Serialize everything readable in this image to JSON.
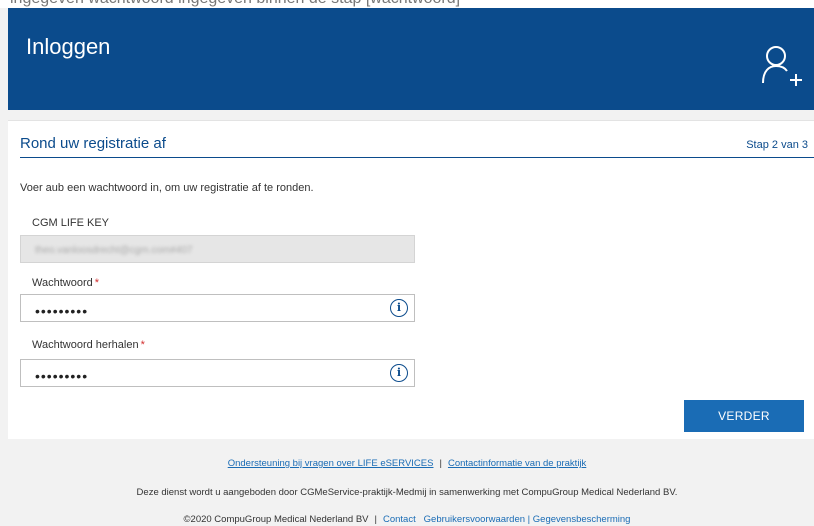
{
  "top_strip_text": "ingegeven wachtwoord ingegeven binnen de stap [wachtwoord]",
  "header": {
    "title": "Inloggen",
    "user_icon": "add-user-icon"
  },
  "card": {
    "title": "Rond uw registratie af",
    "step": "Stap 2 van 3",
    "intro": "Voer aub een wachtwoord in, om uw registratie af te ronden.",
    "life_key_label": "CGM LIFE KEY",
    "life_key_value": "theo.vanloosdrecht@cgm.com#407",
    "password_label": "Wachtwoord",
    "password_value": "•••••••••",
    "password_repeat_label": "Wachtwoord herhalen",
    "password_repeat_value": "•••••••••",
    "required_mark": "*",
    "info_glyph": "i",
    "submit_label": "VERDER"
  },
  "footer": {
    "support_link": "Ondersteuning bij vragen over LIFE eSERVICES",
    "separator": "|",
    "contact_practice_link": "Contactinformatie van de praktijk",
    "service_text": "Deze dienst wordt u aangeboden door CGMeService-praktijk-Medmij in samenwerking met CompuGroup Medical Nederland BV.",
    "copyright": "©2020 CompuGroup Medical Nederland BV",
    "contact_link": "Contact",
    "terms_link": "Gebruikersvoorwaarden | Gegevensbescherming"
  },
  "colors": {
    "header_bg": "#0b4b8c",
    "button_bg": "#1a6cb5",
    "required": "#d32f2f"
  }
}
